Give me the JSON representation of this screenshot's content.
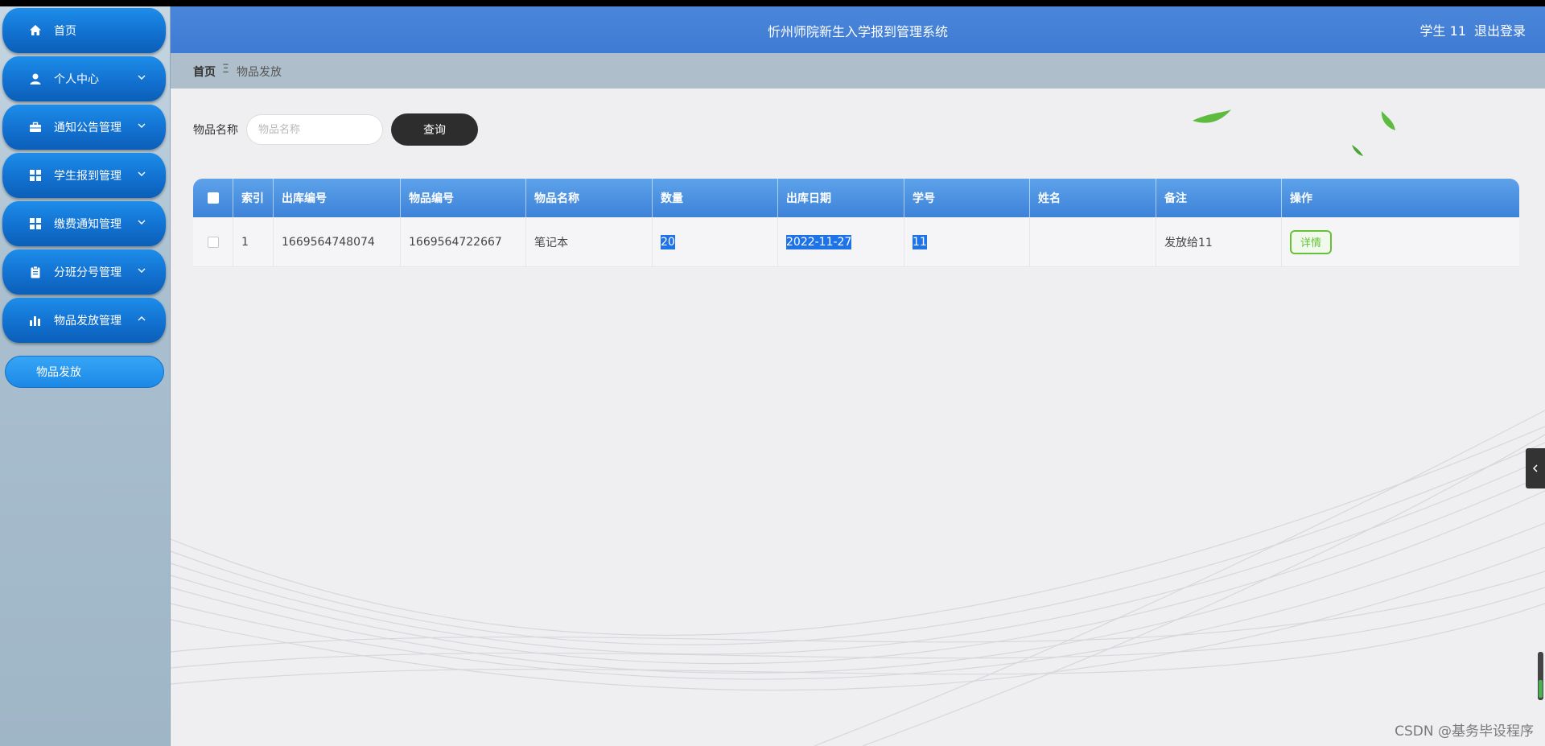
{
  "app": {
    "title": "忻州师院新生入学报到管理系统",
    "user": "学生 11",
    "logout": "退出登录"
  },
  "sidebar": {
    "items": [
      {
        "label": "首页",
        "icon": "home-icon",
        "expandable": false
      },
      {
        "label": "个人中心",
        "icon": "user-icon",
        "expandable": true
      },
      {
        "label": "通知公告管理",
        "icon": "briefcase-icon",
        "expandable": true
      },
      {
        "label": "学生报到管理",
        "icon": "grid-icon",
        "expandable": true
      },
      {
        "label": "缴费通知管理",
        "icon": "grid-icon",
        "expandable": true
      },
      {
        "label": "分班分号管理",
        "icon": "clipboard-icon",
        "expandable": true
      },
      {
        "label": "物品发放管理",
        "icon": "bar-chart-icon",
        "expandable": true,
        "expanded": true
      }
    ],
    "subitem": "物品发放"
  },
  "breadcrumb": {
    "home": "首页",
    "separator": "Ξ",
    "current": "物品发放"
  },
  "search": {
    "label": "物品名称",
    "placeholder": "物品名称",
    "value": "",
    "button": "查询"
  },
  "table": {
    "headers": [
      "索引",
      "出库编号",
      "物品编号",
      "物品名称",
      "数量",
      "出库日期",
      "学号",
      "姓名",
      "备注",
      "操作"
    ],
    "rows": [
      {
        "index": "1",
        "out_no": "1669564748074",
        "item_no": "1669564722667",
        "item_name": "笔记本",
        "quantity": "20",
        "out_date": "2022-11-27",
        "student_no": "11",
        "name": "",
        "remark": "发放给11",
        "action": "详情"
      }
    ]
  },
  "watermark": "CSDN @基务毕设程序",
  "colors": {
    "header": "#4a86d9",
    "menu": "#1271d1",
    "table_header": "#3c82d8",
    "detail_button": "#67c23a",
    "query_button": "#2d2d2d"
  }
}
